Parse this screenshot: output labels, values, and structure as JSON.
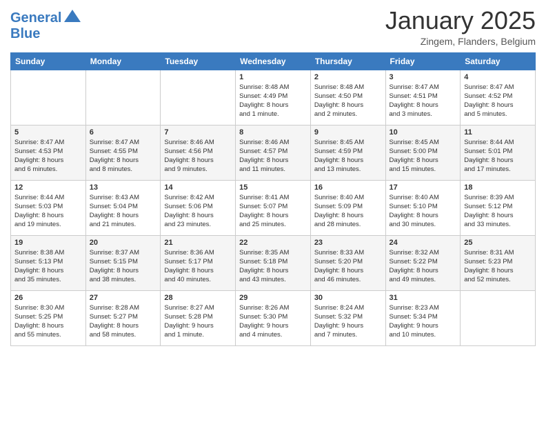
{
  "header": {
    "logo_line1": "General",
    "logo_line2": "Blue",
    "month": "January 2025",
    "location": "Zingem, Flanders, Belgium"
  },
  "weekdays": [
    "Sunday",
    "Monday",
    "Tuesday",
    "Wednesday",
    "Thursday",
    "Friday",
    "Saturday"
  ],
  "weeks": [
    [
      {
        "day": "",
        "info": ""
      },
      {
        "day": "",
        "info": ""
      },
      {
        "day": "",
        "info": ""
      },
      {
        "day": "1",
        "info": "Sunrise: 8:48 AM\nSunset: 4:49 PM\nDaylight: 8 hours\nand 1 minute."
      },
      {
        "day": "2",
        "info": "Sunrise: 8:48 AM\nSunset: 4:50 PM\nDaylight: 8 hours\nand 2 minutes."
      },
      {
        "day": "3",
        "info": "Sunrise: 8:47 AM\nSunset: 4:51 PM\nDaylight: 8 hours\nand 3 minutes."
      },
      {
        "day": "4",
        "info": "Sunrise: 8:47 AM\nSunset: 4:52 PM\nDaylight: 8 hours\nand 5 minutes."
      }
    ],
    [
      {
        "day": "5",
        "info": "Sunrise: 8:47 AM\nSunset: 4:53 PM\nDaylight: 8 hours\nand 6 minutes."
      },
      {
        "day": "6",
        "info": "Sunrise: 8:47 AM\nSunset: 4:55 PM\nDaylight: 8 hours\nand 8 minutes."
      },
      {
        "day": "7",
        "info": "Sunrise: 8:46 AM\nSunset: 4:56 PM\nDaylight: 8 hours\nand 9 minutes."
      },
      {
        "day": "8",
        "info": "Sunrise: 8:46 AM\nSunset: 4:57 PM\nDaylight: 8 hours\nand 11 minutes."
      },
      {
        "day": "9",
        "info": "Sunrise: 8:45 AM\nSunset: 4:59 PM\nDaylight: 8 hours\nand 13 minutes."
      },
      {
        "day": "10",
        "info": "Sunrise: 8:45 AM\nSunset: 5:00 PM\nDaylight: 8 hours\nand 15 minutes."
      },
      {
        "day": "11",
        "info": "Sunrise: 8:44 AM\nSunset: 5:01 PM\nDaylight: 8 hours\nand 17 minutes."
      }
    ],
    [
      {
        "day": "12",
        "info": "Sunrise: 8:44 AM\nSunset: 5:03 PM\nDaylight: 8 hours\nand 19 minutes."
      },
      {
        "day": "13",
        "info": "Sunrise: 8:43 AM\nSunset: 5:04 PM\nDaylight: 8 hours\nand 21 minutes."
      },
      {
        "day": "14",
        "info": "Sunrise: 8:42 AM\nSunset: 5:06 PM\nDaylight: 8 hours\nand 23 minutes."
      },
      {
        "day": "15",
        "info": "Sunrise: 8:41 AM\nSunset: 5:07 PM\nDaylight: 8 hours\nand 25 minutes."
      },
      {
        "day": "16",
        "info": "Sunrise: 8:40 AM\nSunset: 5:09 PM\nDaylight: 8 hours\nand 28 minutes."
      },
      {
        "day": "17",
        "info": "Sunrise: 8:40 AM\nSunset: 5:10 PM\nDaylight: 8 hours\nand 30 minutes."
      },
      {
        "day": "18",
        "info": "Sunrise: 8:39 AM\nSunset: 5:12 PM\nDaylight: 8 hours\nand 33 minutes."
      }
    ],
    [
      {
        "day": "19",
        "info": "Sunrise: 8:38 AM\nSunset: 5:13 PM\nDaylight: 8 hours\nand 35 minutes."
      },
      {
        "day": "20",
        "info": "Sunrise: 8:37 AM\nSunset: 5:15 PM\nDaylight: 8 hours\nand 38 minutes."
      },
      {
        "day": "21",
        "info": "Sunrise: 8:36 AM\nSunset: 5:17 PM\nDaylight: 8 hours\nand 40 minutes."
      },
      {
        "day": "22",
        "info": "Sunrise: 8:35 AM\nSunset: 5:18 PM\nDaylight: 8 hours\nand 43 minutes."
      },
      {
        "day": "23",
        "info": "Sunrise: 8:33 AM\nSunset: 5:20 PM\nDaylight: 8 hours\nand 46 minutes."
      },
      {
        "day": "24",
        "info": "Sunrise: 8:32 AM\nSunset: 5:22 PM\nDaylight: 8 hours\nand 49 minutes."
      },
      {
        "day": "25",
        "info": "Sunrise: 8:31 AM\nSunset: 5:23 PM\nDaylight: 8 hours\nand 52 minutes."
      }
    ],
    [
      {
        "day": "26",
        "info": "Sunrise: 8:30 AM\nSunset: 5:25 PM\nDaylight: 8 hours\nand 55 minutes."
      },
      {
        "day": "27",
        "info": "Sunrise: 8:28 AM\nSunset: 5:27 PM\nDaylight: 8 hours\nand 58 minutes."
      },
      {
        "day": "28",
        "info": "Sunrise: 8:27 AM\nSunset: 5:28 PM\nDaylight: 9 hours\nand 1 minute."
      },
      {
        "day": "29",
        "info": "Sunrise: 8:26 AM\nSunset: 5:30 PM\nDaylight: 9 hours\nand 4 minutes."
      },
      {
        "day": "30",
        "info": "Sunrise: 8:24 AM\nSunset: 5:32 PM\nDaylight: 9 hours\nand 7 minutes."
      },
      {
        "day": "31",
        "info": "Sunrise: 8:23 AM\nSunset: 5:34 PM\nDaylight: 9 hours\nand 10 minutes."
      },
      {
        "day": "",
        "info": ""
      }
    ]
  ]
}
